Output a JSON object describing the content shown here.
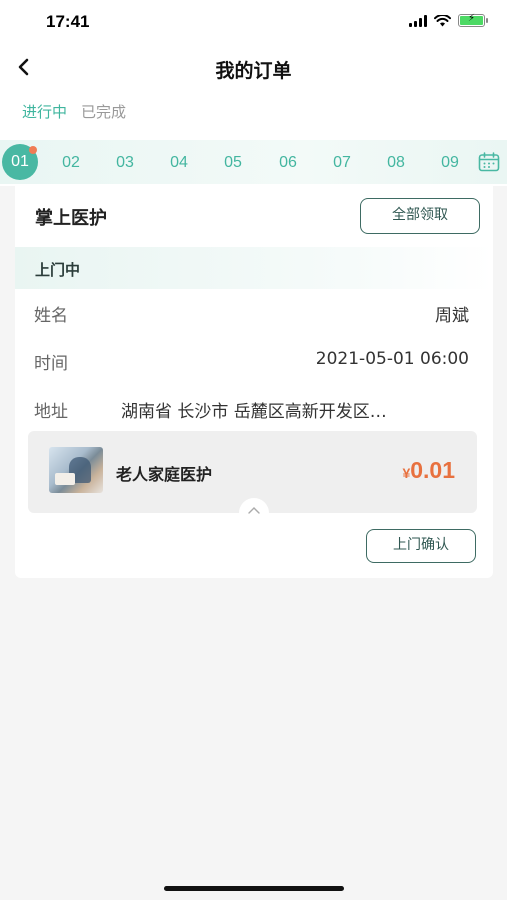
{
  "status_bar": {
    "time": "17:41",
    "battery_color": "#4cd964"
  },
  "nav": {
    "back_icon": "chevron-left-icon",
    "title": "我的订单"
  },
  "status_tabs": [
    {
      "label": "进行中",
      "active": true
    },
    {
      "label": "已完成",
      "active": false
    }
  ],
  "dates": [
    "01",
    "02",
    "03",
    "04",
    "05",
    "06",
    "07",
    "08",
    "09"
  ],
  "active_date": "01",
  "accent_color": "#49b8a3",
  "card": {
    "title": "掌上医护",
    "claim_all_label": "全部领取",
    "state": "上门中",
    "rows": {
      "name_label": "姓名",
      "name_value": "周斌",
      "time_label": "时间",
      "time_value": "2021-05-01 06:00",
      "address_label": "地址",
      "address_value": "湖南省 长沙市 岳麓区高新开发区…"
    },
    "item": {
      "name": "老人家庭医护",
      "currency": "¥",
      "price": "0.01",
      "price_color": "#e8713f"
    },
    "confirm_label": "上门确认"
  }
}
